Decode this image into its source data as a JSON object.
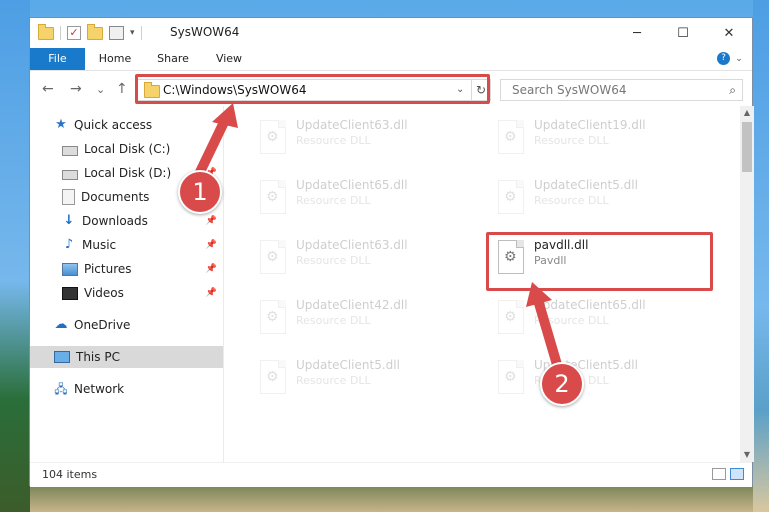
{
  "window": {
    "title": "SysWOW64",
    "controls": {
      "minimize": "─",
      "maximize": "☐",
      "close": "✕"
    }
  },
  "quick_access_toolbar": {
    "separator": "|",
    "dropdown": "▾"
  },
  "ribbon": {
    "tabs": [
      "File",
      "Home",
      "Share",
      "View"
    ],
    "expand": "⌄",
    "help": "?"
  },
  "navigation": {
    "back": "←",
    "forward": "→",
    "recent": "⌄",
    "up": "↑",
    "address": "C:\\Windows\\SysWOW64",
    "address_dropdown": "⌄",
    "refresh": "↻",
    "search_placeholder": "Search SysWOW64"
  },
  "nav_pane": {
    "items": [
      {
        "label": "Quick access",
        "icon": "star-icon"
      },
      {
        "label": "Local Disk (C:)",
        "icon": "drive-icon"
      },
      {
        "label": "Local Disk (D:)",
        "icon": "drive-icon"
      },
      {
        "label": "Documents",
        "icon": "documents-icon"
      },
      {
        "label": "Downloads",
        "icon": "downloads-icon"
      },
      {
        "label": "Music",
        "icon": "music-icon"
      },
      {
        "label": "Pictures",
        "icon": "pictures-icon"
      },
      {
        "label": "Videos",
        "icon": "videos-icon"
      },
      {
        "label": "OneDrive",
        "icon": "cloud-icon"
      },
      {
        "label": "This PC",
        "icon": "computer-icon"
      },
      {
        "label": "Network",
        "icon": "network-icon"
      }
    ],
    "pin_glyph": "📌"
  },
  "files": [
    {
      "name": "UpdateClient63.dll",
      "type": "Resource DLL"
    },
    {
      "name": "UpdateClient19.dll",
      "type": "Resource DLL"
    },
    {
      "name": "UpdateClient65.dll",
      "type": "Resource DLL"
    },
    {
      "name": "UpdateClient5.dll",
      "type": "Resource DLL"
    },
    {
      "name": "UpdateClient63.dll",
      "type": "Resource DLL"
    },
    {
      "name": "pavdll.dll",
      "type": "Pavdll"
    },
    {
      "name": "UpdateClient42.dll",
      "type": "Resource DLL"
    },
    {
      "name": "UpdateClient65.dll",
      "type": "Resource DLL"
    },
    {
      "name": "UpdateClient5.dll",
      "type": "Resource DLL"
    },
    {
      "name": "UpdateClient5.dll",
      "type": "Resource DLL"
    }
  ],
  "scrollbar": {
    "up": "▲",
    "down": "▼"
  },
  "status": {
    "item_count": "104 items"
  },
  "annotations": {
    "marker1": "1",
    "marker2": "2"
  },
  "colors": {
    "accent": "#1979ca",
    "highlight": "#d94a4a"
  }
}
